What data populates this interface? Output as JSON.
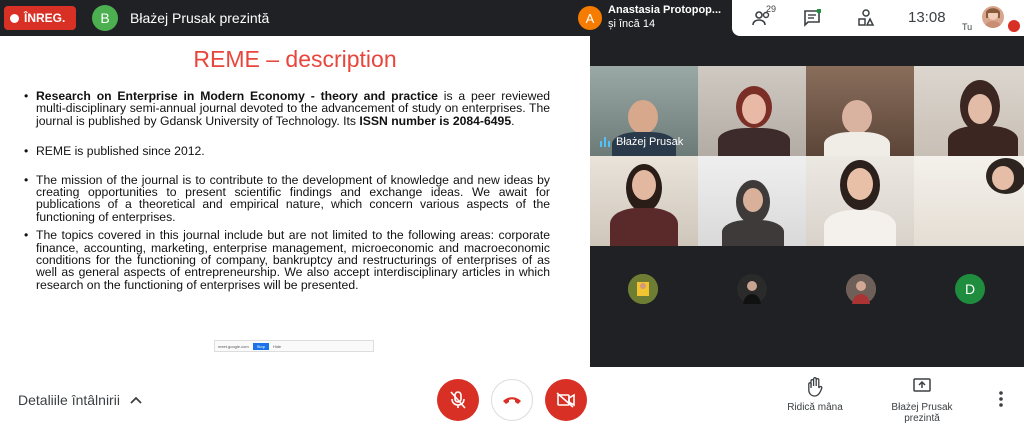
{
  "topbar": {
    "recording_label": "ÎNREG.",
    "presenter_initial": "B",
    "presenter_label": "Błażej Prusak prezintă",
    "speaker_initial": "A",
    "speaker_name": "Anastasia Protopop...",
    "speaker_more": "și încă 14",
    "participants_count": "29",
    "clock": "13:08",
    "self_label": "Tu"
  },
  "slide": {
    "title": "REME – description",
    "p1_bold": "Research on Enterprise in Modern Economy - theory and practice",
    "p1_text": " is a peer reviewed multi-disciplinary semi-annual journal devoted to the advancement of study on enterprises. The journal is published by Gdansk University of Technology. Its ",
    "p1_issn": "ISSN number is 2084-6495",
    "p1_end": ".",
    "p2": "REME is published since 2012.",
    "p3": "The mission of the journal is to contribute to the development of knowledge and new ideas by creating opportunities to present scientific findings and exchange ideas. We await for publications of a theoretical and empirical nature, which concern various aspects of the functioning of enterprises.",
    "p4": "The topics covered in this journal include but are not limited to the following areas: corporate finance, accounting, marketing, enterprise management, microeconomic and macroeconomic conditions for the functioning of company, bankruptcy and restructurings of enterprises of as well as general aspects of entrepreneurship. We also accept interdisciplinary articles in which research on the functioning of enterprises will be presented."
  },
  "video": {
    "tile_label": "Błażej Prusak",
    "mini_initial": "D"
  },
  "bottombar": {
    "meeting_details": "Detaliile întâlnirii",
    "raise_hand": "Ridică mâna",
    "presenting_line1": "Błażej Prusak",
    "presenting_line2": "prezintă"
  },
  "colors": {
    "recording": "#d93025",
    "title_red": "#e8453c",
    "presenter_avatar": "#4caf50",
    "speaker_avatar": "#f57c00",
    "mini_avatar": "#1e8e3e"
  },
  "icons": [
    "record-dot-icon",
    "people-icon",
    "chat-icon",
    "activities-icon",
    "mic-off-icon",
    "hangup-icon",
    "camera-off-icon",
    "hand-icon",
    "present-icon",
    "more-vert-icon",
    "chevron-up-icon"
  ]
}
